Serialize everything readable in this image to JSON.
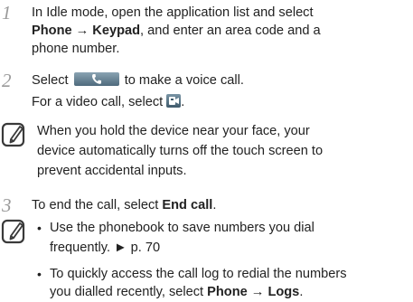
{
  "step1": {
    "number": "1",
    "text_a": "In Idle mode, open the application list and select",
    "phone": "Phone",
    "arrow": " → ",
    "keypad": "Keypad",
    "text_b": ", and enter an area code and a",
    "text_c": "phone number."
  },
  "step2": {
    "number": "2",
    "select": "Select",
    "after_button": "to make a voice call.",
    "video_text": "For a video call, select",
    "video_end": "."
  },
  "note1": {
    "lines": [
      "When you hold the device near your face, your",
      "device automatically turns off the touch screen to",
      "prevent accidental inputs."
    ]
  },
  "step3": {
    "number": "3",
    "text": "To end the call, select ",
    "end_call": "End call",
    "end": "."
  },
  "note2": {
    "bullet1_line1": "Use the phonebook to save numbers you dial",
    "bullet1_line2": "frequently. ► p. 70",
    "bullet2_line1": "To quickly access the call log to redial the numbers",
    "bullet2_line2": "you dialled recently, select ",
    "phone": "Phone",
    "arrow": " → ",
    "logs": "Logs",
    "end": "."
  },
  "icons": {
    "call_button": "phone-handset-icon",
    "video_button": "video-call-icon",
    "note": "note-pencil-icon"
  },
  "colors": {
    "button": "#5b7686",
    "number": "#9a9a9a"
  }
}
